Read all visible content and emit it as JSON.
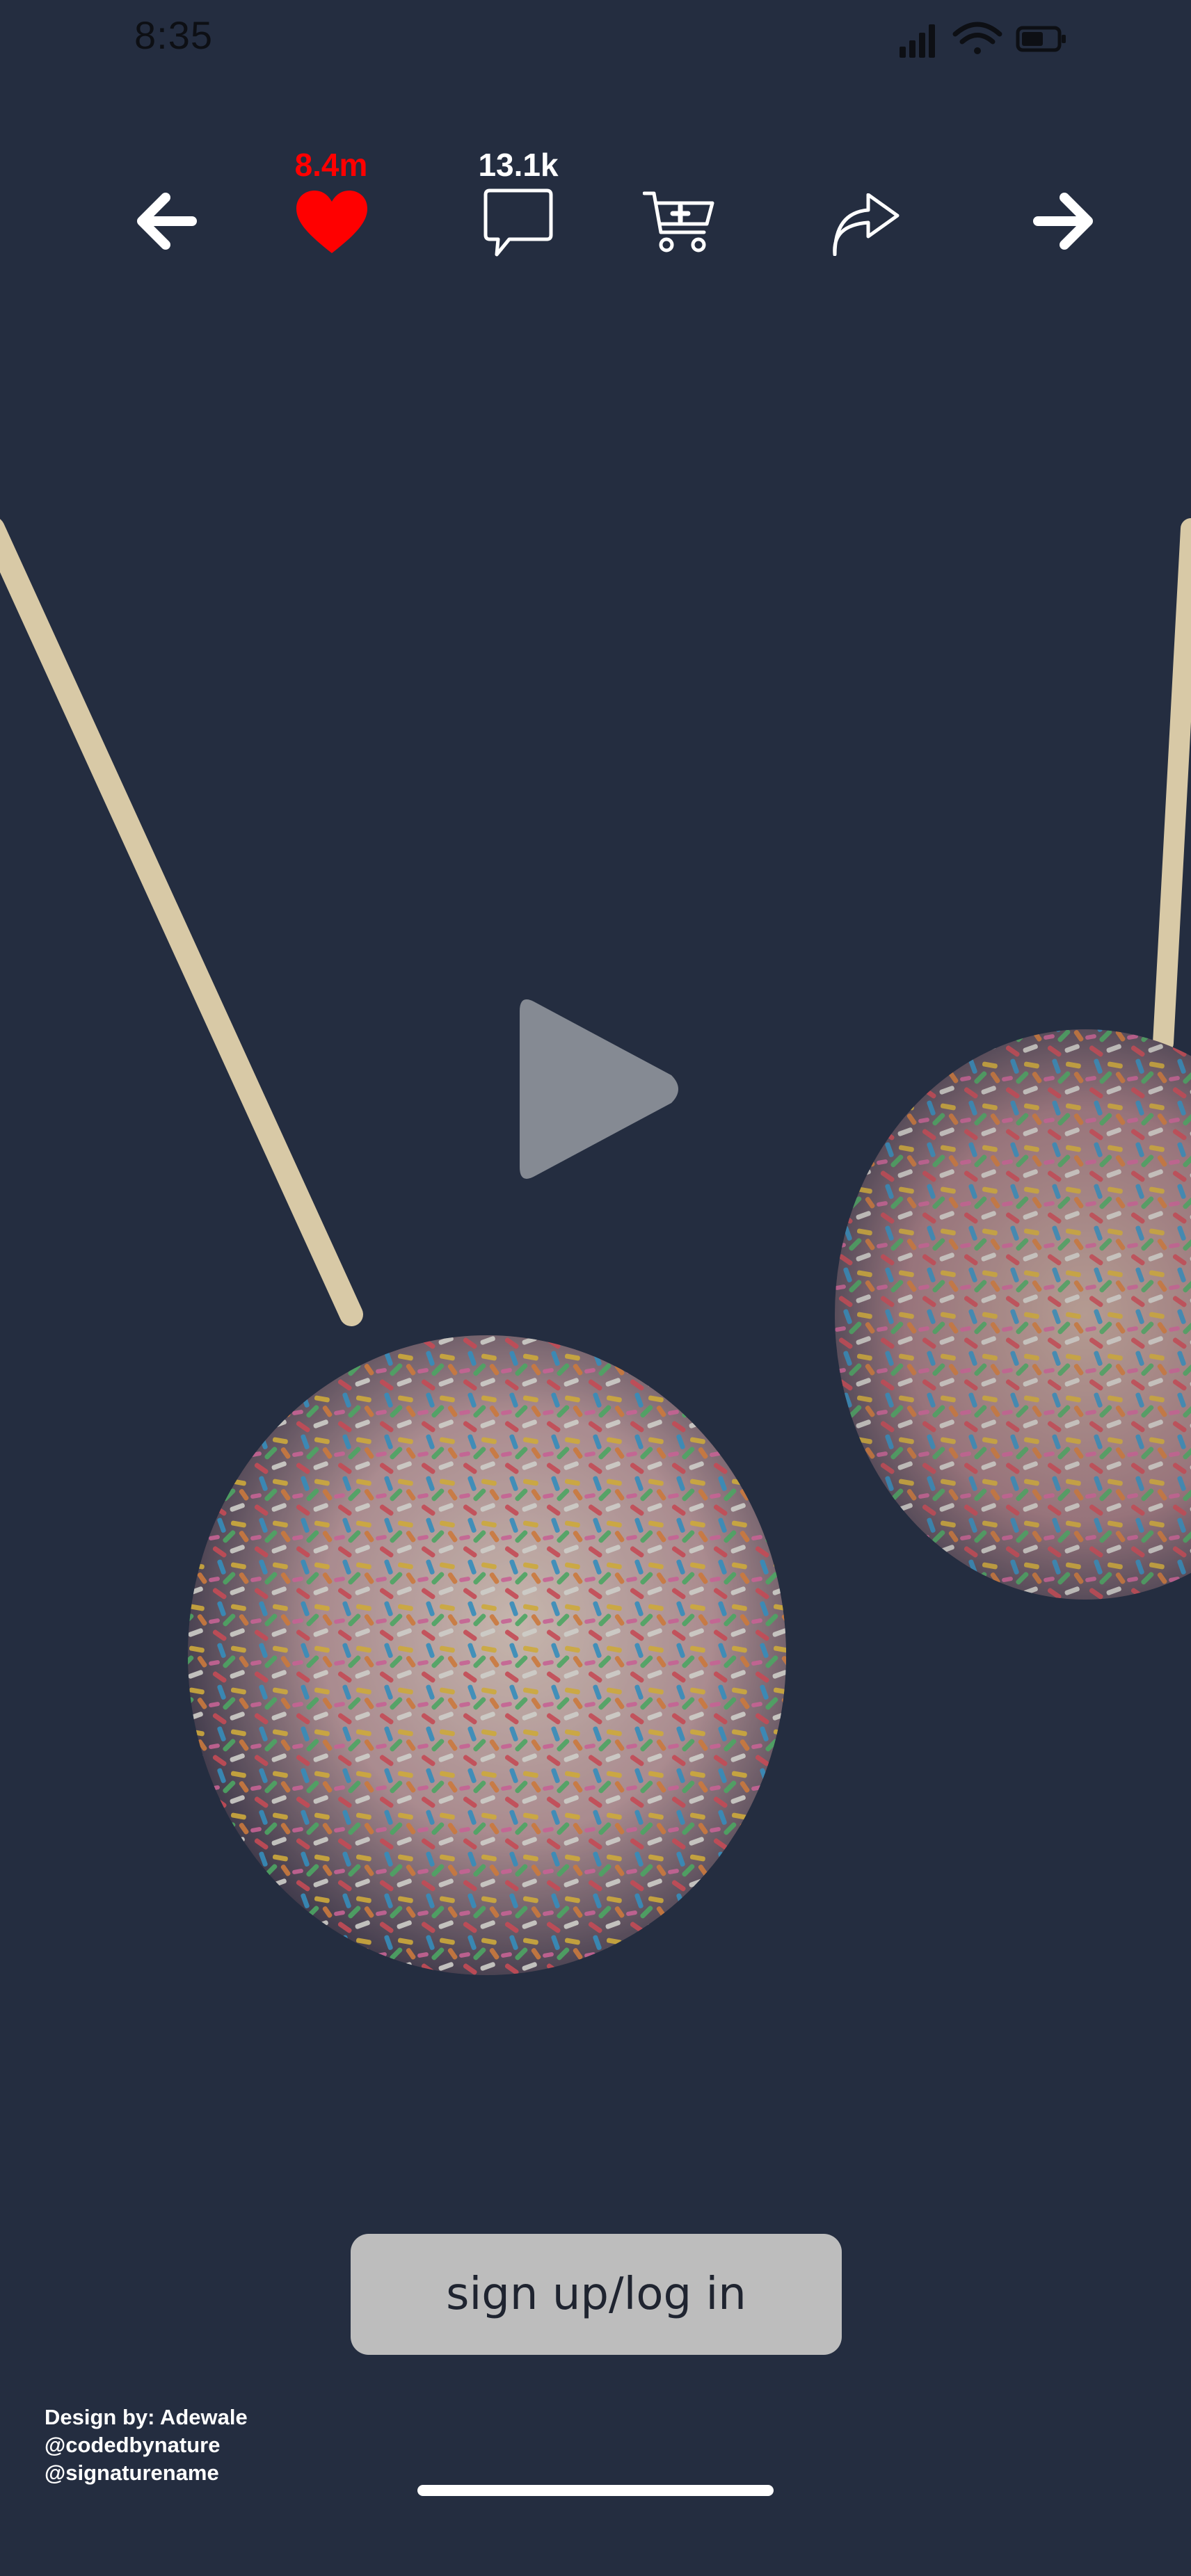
{
  "status_bar": {
    "time": "8:35",
    "icons": [
      "cellular-signal-icon",
      "wifi-icon",
      "battery-icon"
    ]
  },
  "top_bar": {
    "likes_count": "8.4m",
    "comments_count": "13.1k",
    "icons": [
      "back-arrow-icon",
      "heart-icon",
      "comment-icon",
      "add-to-cart-icon",
      "share-icon",
      "forward-arrow-icon"
    ]
  },
  "media": {
    "description_icon": "play-icon"
  },
  "auth": {
    "button_label": "sign up/log in"
  },
  "credits": {
    "line1": "Design by: Adewale",
    "line2": "@codedbynature",
    "line3": "@signaturename"
  },
  "colors": {
    "background": "#242d40",
    "like": "#ff0000",
    "button": "#bdbdbd",
    "text_light": "#ffffff"
  }
}
